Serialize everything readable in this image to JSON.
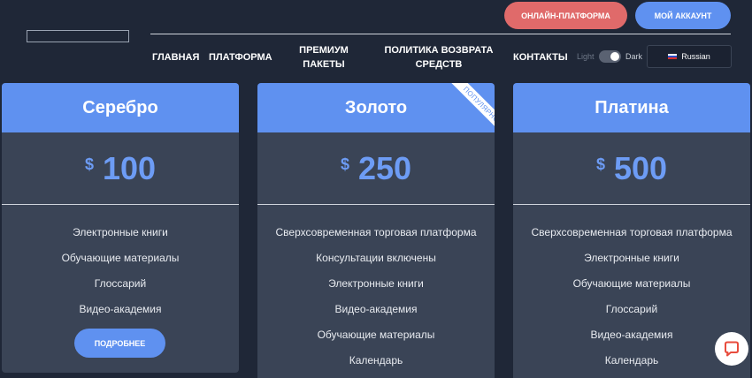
{
  "header": {
    "logo_alt": "",
    "platform_button": "ОНЛАЙН-ПЛАТФОРМА",
    "account_button": "МОЙ АККАУНТ",
    "nav": {
      "home": "ГЛАВНАЯ",
      "platform": "ПЛАТФОРМА",
      "premium": "ПРЕМИУМ ПАКЕТЫ",
      "refund": "ПОЛИТИКА ВОЗВРАТА СРЕДСТВ",
      "contacts": "КОНТАКТЫ"
    },
    "theme": {
      "light": "Light",
      "dark": "Dark",
      "selected": "Dark"
    },
    "language": "Russian"
  },
  "plans": [
    {
      "name": "Серебро",
      "currency": "$",
      "price": "100",
      "features": [
        "Электронные книги",
        "Обучающие материалы",
        "Глоссарий",
        "Видео-академия"
      ],
      "button": "ПОДРОБНЕЕ"
    },
    {
      "name": "Золото",
      "currency": "$",
      "price": "250",
      "ribbon": "ПОПУЛЯРНО",
      "features": [
        "Сверхсовременная торговая платформа",
        "Консультации включены",
        "Электронные книги",
        "Видео-академия",
        "Обучающие материалы",
        "Календарь"
      ]
    },
    {
      "name": "Платина",
      "currency": "$",
      "price": "500",
      "features": [
        "Сверхсовременная торговая платформа",
        "Электронные книги",
        "Обучающие материалы",
        "Глоссарий",
        "Видео-академия",
        "Календарь"
      ]
    }
  ],
  "colors": {
    "background": "#1f2737",
    "card": "#3a4456",
    "accent_blue": "#5f91f0",
    "accent_red": "#e06a6a",
    "price_text": "#6d9cf5",
    "chat_icon": "#e84c3d"
  },
  "icons": {
    "chat": "chat-bubble-icon",
    "flag": "russia-flag-icon"
  }
}
